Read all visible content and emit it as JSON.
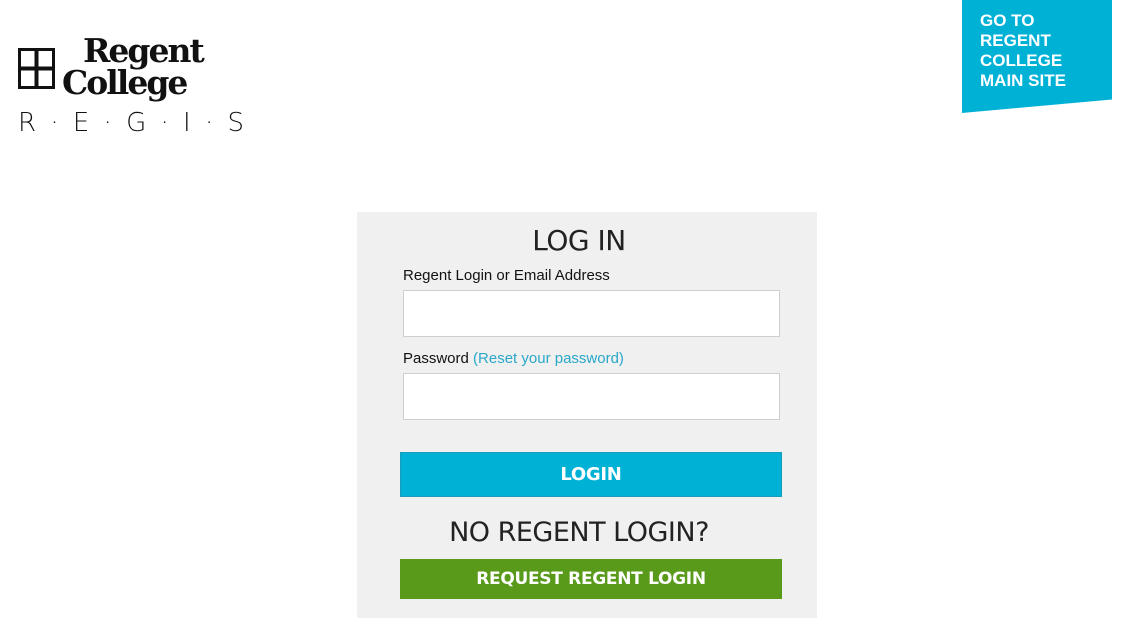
{
  "logo": {
    "line1": "Regent",
    "line2": "College",
    "tagline": "R · E · G · I · S"
  },
  "main_site_link": {
    "label": "GO TO REGENT COLLEGE MAIN SITE",
    "bg_color": "#00b1d6"
  },
  "login_form": {
    "title": "LOG IN",
    "username_label": "Regent Login or Email Address",
    "username_value": "",
    "password_label": "Password",
    "reset_password_link": "(Reset your password)",
    "password_value": "",
    "login_button": "LOGIN",
    "login_button_color": "#00b1d6",
    "no_login_heading": "NO REGENT LOGIN?",
    "request_button": "REQUEST REGENT LOGIN",
    "request_button_color": "#5a9a1a"
  },
  "icons": {
    "logo_mark": "window-cross-icon"
  }
}
